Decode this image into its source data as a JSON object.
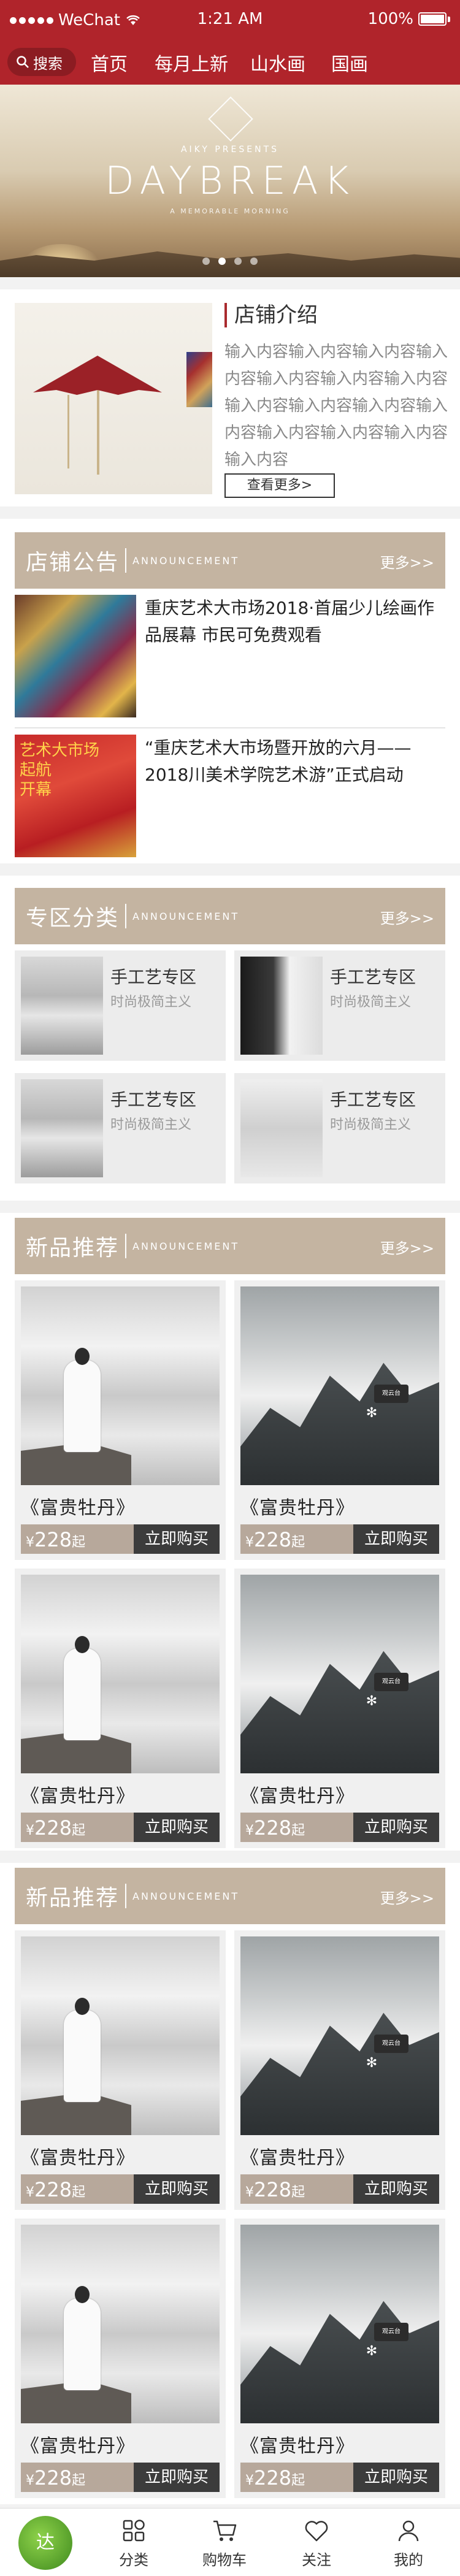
{
  "status_bar": {
    "carrier": "WeChat",
    "time": "1:21 AM",
    "battery": "100%"
  },
  "nav": {
    "search_label": "搜索",
    "links": [
      "首页",
      "每月上新",
      "山水画",
      "国画"
    ]
  },
  "banner": {
    "presents": "AIKY PRESENTS",
    "title": "DAYBREAK",
    "subtitle": "A MEMORABLE MORNING",
    "dots": 4,
    "active_dot": 1
  },
  "shop": {
    "title": "店铺介绍",
    "description": "输入内容输入内容输入内容输入内容输入内容输入内容输入内容输入内容输入内容输入内容输入内容输入内容输入内容输入内容输入内容",
    "more_button": "查看更多>"
  },
  "notice": {
    "title": "店铺公告",
    "subtitle": "ANNOUNCEMENT",
    "more": "更多>>",
    "items": [
      {
        "text": "重庆艺术大市场2018·首届少儿绘画作品展幕 市民可免费观看"
      },
      {
        "text": "“重庆艺术大市场暨开放的六月——2018川美术学院艺术游”正式启动"
      }
    ]
  },
  "zones": {
    "title": "专区分类",
    "subtitle": "ANNOUNCEMENT",
    "more": "更多>>",
    "items": [
      {
        "name": "手工艺专区",
        "desc": "时尚极简主义"
      },
      {
        "name": "手工艺专区",
        "desc": "时尚极简主义"
      },
      {
        "name": "手工艺专区",
        "desc": "时尚极简主义"
      },
      {
        "name": "手工艺专区",
        "desc": "时尚极简主义"
      }
    ]
  },
  "new1": {
    "title": "新品推荐",
    "subtitle": "ANNOUNCEMENT",
    "more": "更多>>",
    "products": [
      {
        "name": "《富贵牡丹》",
        "price": "228",
        "unit": "起",
        "currency": "¥",
        "buy": "立即购买"
      },
      {
        "name": "《富贵牡丹》",
        "price": "228",
        "unit": "起",
        "currency": "¥",
        "buy": "立即购买"
      },
      {
        "name": "《富贵牡丹》",
        "price": "228",
        "unit": "起",
        "currency": "¥",
        "buy": "立即购买"
      },
      {
        "name": "《富贵牡丹》",
        "price": "228",
        "unit": "起",
        "currency": "¥",
        "buy": "立即购买"
      }
    ]
  },
  "new2": {
    "title": "新品推荐",
    "subtitle": "ANNOUNCEMENT",
    "more": "更多>>",
    "products": [
      {
        "name": "《富贵牡丹》",
        "price": "228",
        "unit": "起",
        "currency": "¥",
        "buy": "立即购买"
      },
      {
        "name": "《富贵牡丹》",
        "price": "228",
        "unit": "起",
        "currency": "¥",
        "buy": "立即购买"
      },
      {
        "name": "《富贵牡丹》",
        "price": "228",
        "unit": "起",
        "currency": "¥",
        "buy": "立即购买"
      },
      {
        "name": "《富贵牡丹》",
        "price": "228",
        "unit": "起",
        "currency": "¥",
        "buy": "立即购买"
      }
    ]
  },
  "tabbar": {
    "logo_text": "达",
    "tabs": [
      "分类",
      "购物车",
      "关注",
      "我的"
    ]
  }
}
